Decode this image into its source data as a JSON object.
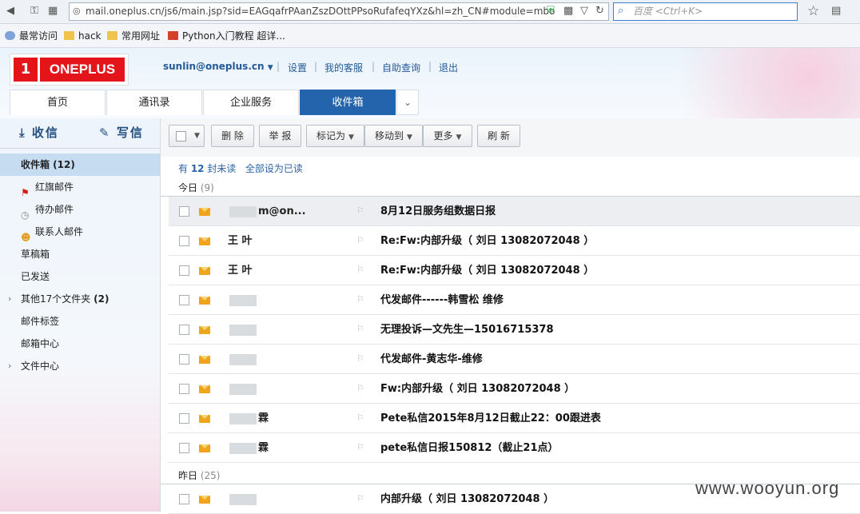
{
  "browser": {
    "url": "mail.oneplus.cn/js6/main.jsp?sid=EAGqafrPAanZszDOttPPsoRufafeqYXz&hl=zh_CN#module=mbo",
    "search_placeholder": "百度 <Ctrl+K>",
    "bookmarks": [
      "最常访问",
      "hack",
      "常用网址",
      "Python入门教程 超详..."
    ]
  },
  "header": {
    "logo_text": "ONEPLUS",
    "logo_mark": "1",
    "user": "sunlin@oneplus.cn",
    "links": [
      "设置",
      "我的客服",
      "自助查询",
      "退出"
    ]
  },
  "tabs": [
    "首页",
    "通讯录",
    "企业服务",
    "收件箱"
  ],
  "sidebar": {
    "receive": "收信",
    "compose": "写信",
    "items": [
      {
        "label": "收件箱 (12)",
        "icon": "inbox"
      },
      {
        "label": "红旗邮件",
        "icon": "red-flag-icon"
      },
      {
        "label": "待办邮件",
        "icon": "clock-icon"
      },
      {
        "label": "联系人邮件",
        "icon": "contact-icon"
      },
      {
        "label": "草稿箱",
        "icon": ""
      },
      {
        "label": "已发送",
        "icon": ""
      },
      {
        "label": "其他17个文件夹",
        "count": "(2)",
        "icon": ""
      },
      {
        "label": "邮件标签",
        "icon": ""
      },
      {
        "label": "邮箱中心",
        "icon": ""
      },
      {
        "label": "文件中心",
        "icon": ""
      }
    ]
  },
  "toolbar": {
    "delete": "删 除",
    "report": "举 报",
    "mark_as": "标记为",
    "move_to": "移动到",
    "more": "更多",
    "refresh": "刷 新"
  },
  "unread": {
    "prefix": "有 ",
    "count": "12",
    "suffix": " 封未读",
    "mark_all": "全部设为已读"
  },
  "groups": {
    "today": {
      "label": "今日",
      "count": "(9)"
    },
    "yesterday": {
      "label": "昨日",
      "count": "(25)"
    }
  },
  "mails": [
    {
      "from": "m@on...",
      "subject": "8月12日服务组数据日报"
    },
    {
      "from": "王 叶",
      "subject": "Re:Fw:内部升级（ 刘日 13082072048 ）"
    },
    {
      "from": "王 叶",
      "subject": "Re:Fw:内部升级（ 刘日 13082072048 ）"
    },
    {
      "from": "",
      "subject": "代发邮件------韩雪松 维修"
    },
    {
      "from": "",
      "subject": "无理投诉—文先生—15016715378"
    },
    {
      "from": "",
      "subject": "代发邮件-黄志华-维修"
    },
    {
      "from": "",
      "subject": "Fw:内部升级（ 刘日 13082072048 ）"
    },
    {
      "from": "霖",
      "subject": "Pete私信2015年8月12日截止22：00跟进表"
    },
    {
      "from": "霖",
      "subject": "pete私信日报150812（截止21点）"
    },
    {
      "from": "",
      "subject": "内部升级（ 刘日 13082072048 ）"
    }
  ],
  "watermark": "www.wooyun.org"
}
